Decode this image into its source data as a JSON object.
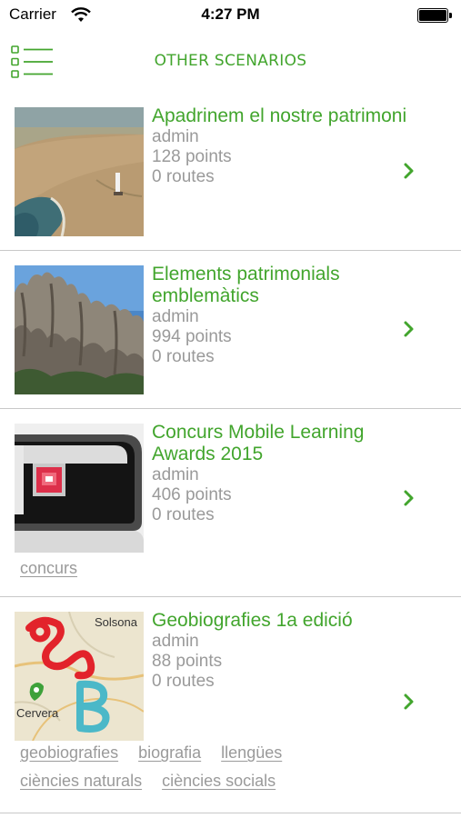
{
  "status_bar": {
    "carrier": "Carrier",
    "time": "4:27 PM",
    "battery_level": 1.0
  },
  "nav": {
    "title": "OTHER SCENARIOS",
    "menu_icon": "list-menu-icon"
  },
  "colors": {
    "accent": "#42a52d",
    "meta_text": "#9a9a9a",
    "separator": "#c8c8c8"
  },
  "scenarios": [
    {
      "title": "Apadrinem el nostre patrimoni",
      "author": "admin",
      "points": "128 points",
      "routes": "0 routes",
      "thumbnail": "beach-lighthouse-photo",
      "tags": []
    },
    {
      "title": "Elements patrimonials emblemàtics",
      "author": "admin",
      "points": "994 points",
      "routes": "0 routes",
      "thumbnail": "rock-formations-photo",
      "tags": []
    },
    {
      "title": "Concurs Mobile Learning Awards 2015",
      "author": "admin",
      "points": "406 points",
      "routes": "0 routes",
      "thumbnail": "phone-corner-image",
      "tags": [
        "concurs"
      ]
    },
    {
      "title": "Geobiografies 1a edició",
      "author": "admin",
      "points": "88 points",
      "routes": "0 routes",
      "thumbnail": "map-logo-image",
      "thumbnail_text": [
        "Solsona",
        "Cervera"
      ],
      "tags": [
        "geobiografies",
        "biografia",
        "llengües",
        "ciències naturals",
        "ciències socials"
      ]
    }
  ]
}
